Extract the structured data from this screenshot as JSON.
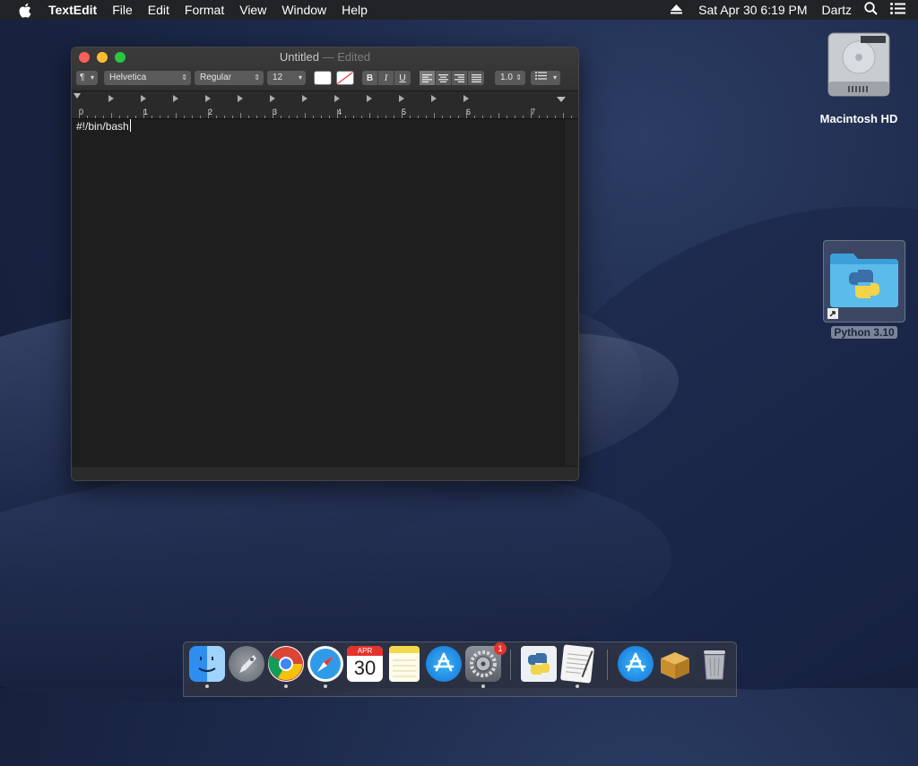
{
  "menubar": {
    "app": "TextEdit",
    "items": [
      "File",
      "Edit",
      "Format",
      "View",
      "Window",
      "Help"
    ],
    "clock": "Sat Apr 30  6:19 PM",
    "user": "Dartz"
  },
  "window": {
    "title": "Untitled",
    "title_suffix": "— Edited",
    "toolbar": {
      "paragraph_style": "¶",
      "font_family": "Helvetica",
      "font_style": "Regular",
      "font_size": "12",
      "bold": "B",
      "italic": "I",
      "underline": "U",
      "line_spacing": "1.0"
    },
    "ruler_numbers": [
      "0",
      "1",
      "2",
      "3",
      "4",
      "5",
      "6",
      "7"
    ],
    "content": "#!/bin/bash"
  },
  "desktop": {
    "disk_label": "Macintosh HD",
    "folder_label": "Python 3.10"
  },
  "dock": {
    "calendar_month": "APR",
    "calendar_day": "30",
    "sysprefs_badge": "1"
  },
  "colors": {
    "close": "#fe5f57",
    "minimize": "#febc2e",
    "maximize": "#28c840",
    "badge": "#e5322d"
  }
}
